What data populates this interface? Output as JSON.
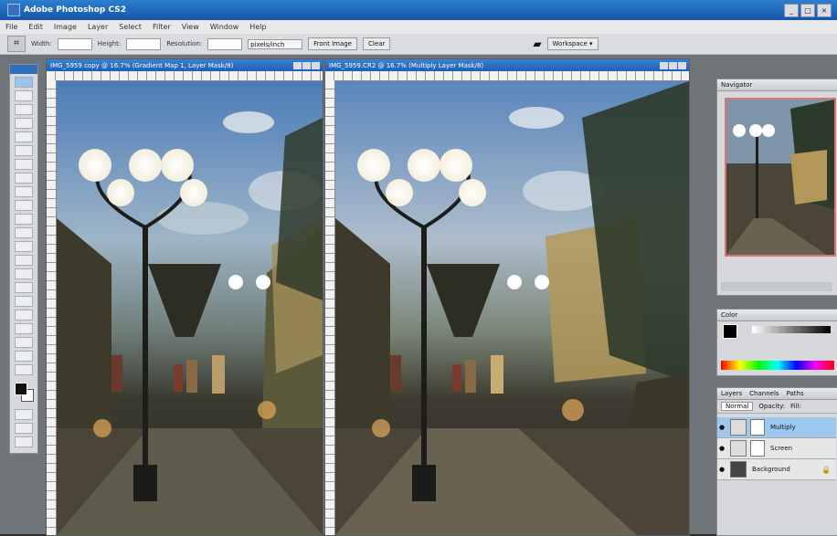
{
  "app": {
    "title": "Adobe Photoshop CS2",
    "window_controls": [
      "_",
      "□",
      "×"
    ]
  },
  "menu": [
    "File",
    "Edit",
    "Image",
    "Layer",
    "Select",
    "Filter",
    "View",
    "Window",
    "Help"
  ],
  "options_bar": {
    "width_label": "Width:",
    "height_label": "Height:",
    "resolution_label": "Resolution:",
    "units": "pixels/inch",
    "front_image": "Front Image",
    "clear": "Clear",
    "workspace": "Workspace ▾"
  },
  "documents": [
    {
      "title": "IMG_5959 copy @ 16.7% (Gradient Map 1, Layer Mask/8)"
    },
    {
      "title": "IMG_5959.CR2 @ 16.7% (Multiply Layer Mask/8)"
    }
  ],
  "panels": {
    "navigator_tab": "Navigator",
    "color_tab": "Color",
    "layers": {
      "tabs": [
        "Layers",
        "Channels",
        "Paths"
      ],
      "blend_mode": "Normal",
      "opacity_label": "Opacity:",
      "fill_label": "Fill:",
      "items": [
        {
          "name": "Multiply",
          "active": true
        },
        {
          "name": "Screen",
          "active": false
        },
        {
          "name": "Background",
          "active": false,
          "locked": true
        }
      ]
    }
  },
  "colors": {
    "titlebar": "#1456a8",
    "active_layer": "#9cc8ee",
    "nav_frame": "#d9776e"
  }
}
